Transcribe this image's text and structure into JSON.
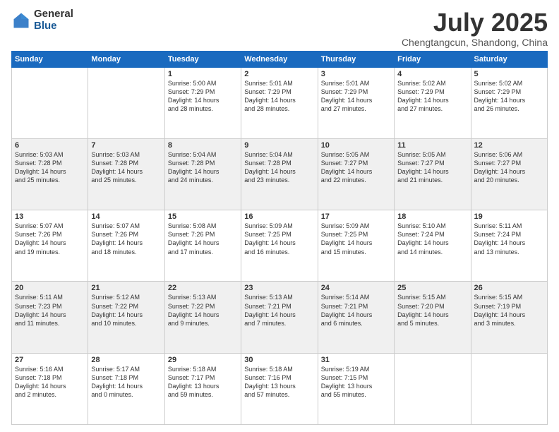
{
  "logo": {
    "general": "General",
    "blue": "Blue"
  },
  "header": {
    "month": "July 2025",
    "location": "Chengtangcun, Shandong, China"
  },
  "weekdays": [
    "Sunday",
    "Monday",
    "Tuesday",
    "Wednesday",
    "Thursday",
    "Friday",
    "Saturday"
  ],
  "weeks": [
    [
      {
        "day": "",
        "lines": []
      },
      {
        "day": "",
        "lines": []
      },
      {
        "day": "1",
        "lines": [
          "Sunrise: 5:00 AM",
          "Sunset: 7:29 PM",
          "Daylight: 14 hours",
          "and 28 minutes."
        ]
      },
      {
        "day": "2",
        "lines": [
          "Sunrise: 5:01 AM",
          "Sunset: 7:29 PM",
          "Daylight: 14 hours",
          "and 28 minutes."
        ]
      },
      {
        "day": "3",
        "lines": [
          "Sunrise: 5:01 AM",
          "Sunset: 7:29 PM",
          "Daylight: 14 hours",
          "and 27 minutes."
        ]
      },
      {
        "day": "4",
        "lines": [
          "Sunrise: 5:02 AM",
          "Sunset: 7:29 PM",
          "Daylight: 14 hours",
          "and 27 minutes."
        ]
      },
      {
        "day": "5",
        "lines": [
          "Sunrise: 5:02 AM",
          "Sunset: 7:29 PM",
          "Daylight: 14 hours",
          "and 26 minutes."
        ]
      }
    ],
    [
      {
        "day": "6",
        "lines": [
          "Sunrise: 5:03 AM",
          "Sunset: 7:28 PM",
          "Daylight: 14 hours",
          "and 25 minutes."
        ]
      },
      {
        "day": "7",
        "lines": [
          "Sunrise: 5:03 AM",
          "Sunset: 7:28 PM",
          "Daylight: 14 hours",
          "and 25 minutes."
        ]
      },
      {
        "day": "8",
        "lines": [
          "Sunrise: 5:04 AM",
          "Sunset: 7:28 PM",
          "Daylight: 14 hours",
          "and 24 minutes."
        ]
      },
      {
        "day": "9",
        "lines": [
          "Sunrise: 5:04 AM",
          "Sunset: 7:28 PM",
          "Daylight: 14 hours",
          "and 23 minutes."
        ]
      },
      {
        "day": "10",
        "lines": [
          "Sunrise: 5:05 AM",
          "Sunset: 7:27 PM",
          "Daylight: 14 hours",
          "and 22 minutes."
        ]
      },
      {
        "day": "11",
        "lines": [
          "Sunrise: 5:05 AM",
          "Sunset: 7:27 PM",
          "Daylight: 14 hours",
          "and 21 minutes."
        ]
      },
      {
        "day": "12",
        "lines": [
          "Sunrise: 5:06 AM",
          "Sunset: 7:27 PM",
          "Daylight: 14 hours",
          "and 20 minutes."
        ]
      }
    ],
    [
      {
        "day": "13",
        "lines": [
          "Sunrise: 5:07 AM",
          "Sunset: 7:26 PM",
          "Daylight: 14 hours",
          "and 19 minutes."
        ]
      },
      {
        "day": "14",
        "lines": [
          "Sunrise: 5:07 AM",
          "Sunset: 7:26 PM",
          "Daylight: 14 hours",
          "and 18 minutes."
        ]
      },
      {
        "day": "15",
        "lines": [
          "Sunrise: 5:08 AM",
          "Sunset: 7:26 PM",
          "Daylight: 14 hours",
          "and 17 minutes."
        ]
      },
      {
        "day": "16",
        "lines": [
          "Sunrise: 5:09 AM",
          "Sunset: 7:25 PM",
          "Daylight: 14 hours",
          "and 16 minutes."
        ]
      },
      {
        "day": "17",
        "lines": [
          "Sunrise: 5:09 AM",
          "Sunset: 7:25 PM",
          "Daylight: 14 hours",
          "and 15 minutes."
        ]
      },
      {
        "day": "18",
        "lines": [
          "Sunrise: 5:10 AM",
          "Sunset: 7:24 PM",
          "Daylight: 14 hours",
          "and 14 minutes."
        ]
      },
      {
        "day": "19",
        "lines": [
          "Sunrise: 5:11 AM",
          "Sunset: 7:24 PM",
          "Daylight: 14 hours",
          "and 13 minutes."
        ]
      }
    ],
    [
      {
        "day": "20",
        "lines": [
          "Sunrise: 5:11 AM",
          "Sunset: 7:23 PM",
          "Daylight: 14 hours",
          "and 11 minutes."
        ]
      },
      {
        "day": "21",
        "lines": [
          "Sunrise: 5:12 AM",
          "Sunset: 7:22 PM",
          "Daylight: 14 hours",
          "and 10 minutes."
        ]
      },
      {
        "day": "22",
        "lines": [
          "Sunrise: 5:13 AM",
          "Sunset: 7:22 PM",
          "Daylight: 14 hours",
          "and 9 minutes."
        ]
      },
      {
        "day": "23",
        "lines": [
          "Sunrise: 5:13 AM",
          "Sunset: 7:21 PM",
          "Daylight: 14 hours",
          "and 7 minutes."
        ]
      },
      {
        "day": "24",
        "lines": [
          "Sunrise: 5:14 AM",
          "Sunset: 7:21 PM",
          "Daylight: 14 hours",
          "and 6 minutes."
        ]
      },
      {
        "day": "25",
        "lines": [
          "Sunrise: 5:15 AM",
          "Sunset: 7:20 PM",
          "Daylight: 14 hours",
          "and 5 minutes."
        ]
      },
      {
        "day": "26",
        "lines": [
          "Sunrise: 5:15 AM",
          "Sunset: 7:19 PM",
          "Daylight: 14 hours",
          "and 3 minutes."
        ]
      }
    ],
    [
      {
        "day": "27",
        "lines": [
          "Sunrise: 5:16 AM",
          "Sunset: 7:18 PM",
          "Daylight: 14 hours",
          "and 2 minutes."
        ]
      },
      {
        "day": "28",
        "lines": [
          "Sunrise: 5:17 AM",
          "Sunset: 7:18 PM",
          "Daylight: 14 hours",
          "and 0 minutes."
        ]
      },
      {
        "day": "29",
        "lines": [
          "Sunrise: 5:18 AM",
          "Sunset: 7:17 PM",
          "Daylight: 13 hours",
          "and 59 minutes."
        ]
      },
      {
        "day": "30",
        "lines": [
          "Sunrise: 5:18 AM",
          "Sunset: 7:16 PM",
          "Daylight: 13 hours",
          "and 57 minutes."
        ]
      },
      {
        "day": "31",
        "lines": [
          "Sunrise: 5:19 AM",
          "Sunset: 7:15 PM",
          "Daylight: 13 hours",
          "and 55 minutes."
        ]
      },
      {
        "day": "",
        "lines": []
      },
      {
        "day": "",
        "lines": []
      }
    ]
  ]
}
